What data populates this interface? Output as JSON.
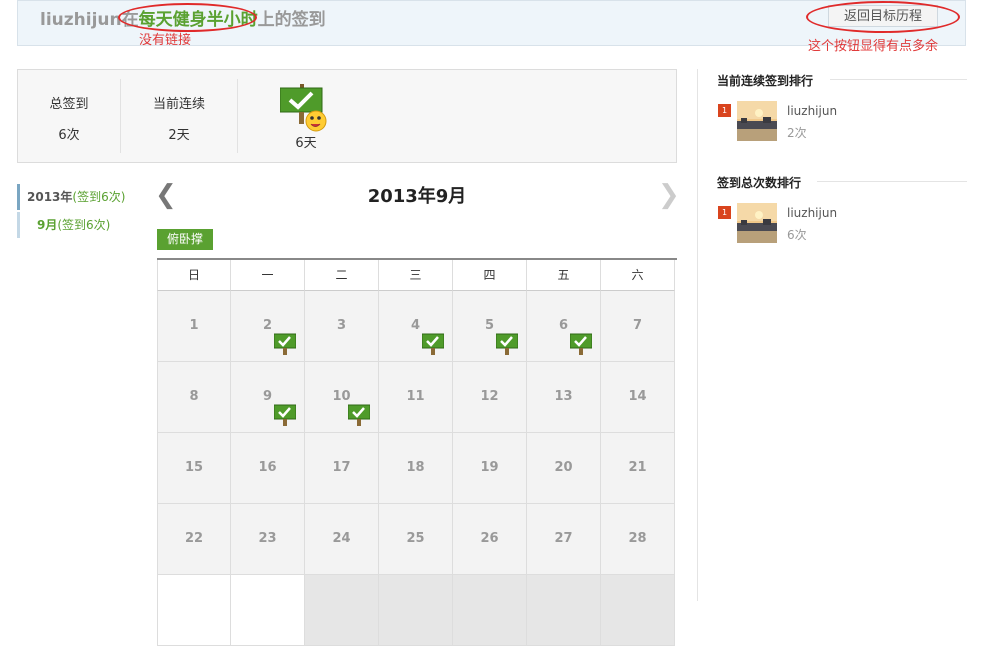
{
  "header": {
    "user": "liuzhijun",
    "connector": "在",
    "goal": "每天健身半小时",
    "suffix": "上的签到",
    "back_button": "返回目标历程"
  },
  "annotations": {
    "no_link": "没有链接",
    "redundant_button": "这个按钮显得有点多余"
  },
  "stats": {
    "total_label": "总签到",
    "total_value": "6次",
    "current_label": "当前连续",
    "current_value": "2天",
    "best_value": "6天"
  },
  "month_nav": {
    "year_label": "2013年",
    "year_count": "(签到6次)",
    "month_label": "9月",
    "month_count": "(签到6次)"
  },
  "calendar": {
    "title": "2013年9月",
    "tag": "俯卧撑",
    "weekdays": [
      "日",
      "一",
      "二",
      "三",
      "四",
      "五",
      "六"
    ],
    "weeks": [
      [
        {
          "d": "1",
          "c": false
        },
        {
          "d": "2",
          "c": true
        },
        {
          "d": "3",
          "c": false
        },
        {
          "d": "4",
          "c": true
        },
        {
          "d": "5",
          "c": true
        },
        {
          "d": "6",
          "c": true
        },
        {
          "d": "7",
          "c": false
        }
      ],
      [
        {
          "d": "8",
          "c": false
        },
        {
          "d": "9",
          "c": true
        },
        {
          "d": "10",
          "c": true
        },
        {
          "d": "11",
          "c": false
        },
        {
          "d": "12",
          "c": false
        },
        {
          "d": "13",
          "c": false
        },
        {
          "d": "14",
          "c": false
        }
      ],
      [
        {
          "d": "15",
          "c": false
        },
        {
          "d": "16",
          "c": false
        },
        {
          "d": "17",
          "c": false
        },
        {
          "d": "18",
          "c": false
        },
        {
          "d": "19",
          "c": false
        },
        {
          "d": "20",
          "c": false
        },
        {
          "d": "21",
          "c": false
        }
      ],
      [
        {
          "d": "22",
          "c": false
        },
        {
          "d": "23",
          "c": false
        },
        {
          "d": "24",
          "c": false
        },
        {
          "d": "25",
          "c": false
        },
        {
          "d": "26",
          "c": false
        },
        {
          "d": "27",
          "c": false
        },
        {
          "d": "28",
          "c": false
        }
      ]
    ]
  },
  "sidebar": {
    "streak_title": "当前连续签到排行",
    "streak_rank": [
      {
        "rank": "1",
        "user": "liuzhijun",
        "value": "2次"
      }
    ],
    "total_title": "签到总次数排行",
    "total_rank": [
      {
        "rank": "1",
        "user": "liuzhijun",
        "value": "6次"
      }
    ]
  },
  "colors": {
    "accent_green": "#5aa131",
    "annotation_red": "#e03a3a",
    "rank_badge": "#d9441e"
  },
  "icons": {
    "checkin_flag": "green-flag-check-icon",
    "prev": "chevron-left-icon",
    "next": "chevron-right-icon"
  }
}
